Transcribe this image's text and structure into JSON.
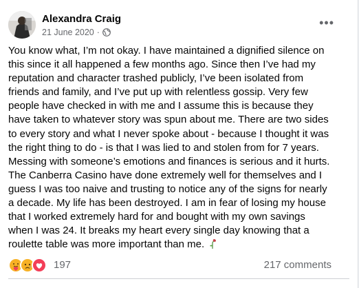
{
  "post": {
    "author": "Alexandra Craig",
    "date": "21 June 2020",
    "separator": "·",
    "privacy_icon": "globe-icon",
    "more_label": "•••",
    "text": "You know what, I’m not okay. I have maintained a dignified silence on\nthis since it all happened a few months ago. Since then I’ve had my\nreputation and character trashed publicly, I’ve been isolated from\nfriends and family, and I’ve put up with relentless gossip. Very few\npeople have checked in with me and I assume this is because they\nhave taken to whatever story was spun about me. There are two sides\nto every story and what I never spoke about - because I thought it was\nthe right thing to do - is that I was lied to and stolen from for 7 years.\nMessing with someone’s emotions and finances is serious and it hurts.\nThe Canberra Casino have done extremely well for themselves and I\nguess I was too naive and trusting to notice any of the signs for nearly\na decade. My life has been destroyed. I am in fear of losing my house\nthat I worked extremely hard for and bought with my own savings\nwhen I was 24. It breaks my heart every single day knowing that a\nroulette table was more important than me. ",
    "end_emoji": "wilted-rose-icon"
  },
  "footer": {
    "reactions": [
      "care-icon",
      "sad-icon",
      "love-icon"
    ],
    "reaction_count": "197",
    "comments": "217 comments"
  },
  "colors": {
    "text": "#050505",
    "secondary": "#65676b",
    "love": "#f33e58",
    "sad": "#f7b125"
  }
}
